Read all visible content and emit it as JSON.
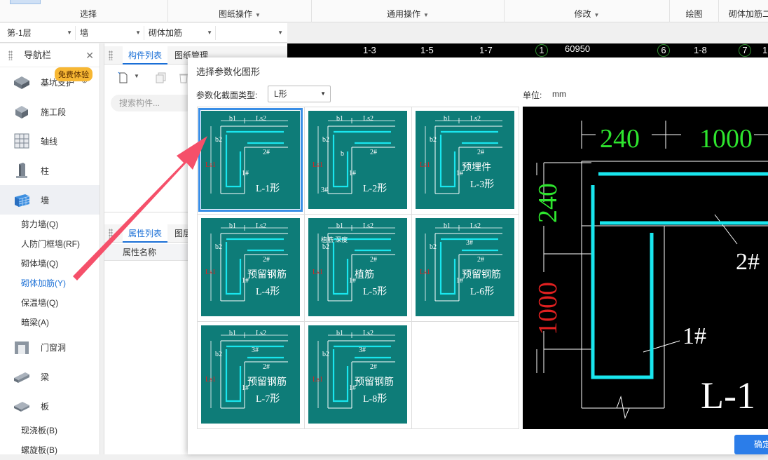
{
  "ribbon": {
    "groups": [
      {
        "label": "选择",
        "has_menu": false
      },
      {
        "label": "图纸操作",
        "has_menu": true
      },
      {
        "label": "通用操作",
        "has_menu": true
      },
      {
        "label": "修改",
        "has_menu": true
      },
      {
        "label": "绘图",
        "has_menu": false
      },
      {
        "label": "砌体加筋二",
        "has_menu": false
      }
    ]
  },
  "selectors": {
    "floor": "第-1层",
    "category": "墙",
    "type": "砌体加筋",
    "extra": ""
  },
  "nav": {
    "title": "导航栏",
    "badge": "免费体验",
    "items": [
      {
        "label": "基坑支护",
        "icon": "foundation-pit-icon"
      },
      {
        "label": "施工段",
        "icon": "construction-section-icon"
      },
      {
        "label": "轴线",
        "icon": "axis-grid-icon"
      },
      {
        "label": "柱",
        "icon": "column-icon"
      },
      {
        "label": "墙",
        "icon": "wall-icon"
      }
    ],
    "wall_sub": [
      "剪力墙(Q)",
      "人防门框墙(RF)",
      "砌体墙(Q)",
      "砌体加筋(Y)",
      "保温墙(Q)",
      "暗梁(A)"
    ],
    "items2": [
      {
        "label": "门窗洞",
        "icon": "door-window-icon"
      },
      {
        "label": "梁",
        "icon": "beam-icon"
      },
      {
        "label": "板",
        "icon": "slab-icon"
      }
    ],
    "slab_sub": [
      "现浇板(B)",
      "螺旋板(B)"
    ]
  },
  "component": {
    "tabs": [
      "构件列表",
      "图纸管理"
    ],
    "search_placeholder": "搜索构件...",
    "prop_tabs": [
      "属性列表",
      "图层"
    ],
    "prop_header": "属性名称"
  },
  "cad_axes": [
    "1-3",
    "1-5",
    "1-7",
    "1",
    "60950",
    "6",
    "1-8",
    "7",
    "1"
  ],
  "dialog": {
    "title": "选择参数化图形",
    "type_label": "参数化截面类型:",
    "type_value": "L形",
    "unit_label": "单位:",
    "unit_value": "mm",
    "ok_label": "确定",
    "shapes": [
      {
        "name": "L-1形",
        "note": ""
      },
      {
        "name": "L-2形",
        "note": ""
      },
      {
        "name": "L-3形",
        "note": "预埋件"
      },
      {
        "name": "L-4形",
        "note": "预留钢筋"
      },
      {
        "name": "L-5形",
        "note": "植筋"
      },
      {
        "name": "L-6形",
        "note": "预留钢筋"
      },
      {
        "name": "L-7形",
        "note": "预留钢筋"
      },
      {
        "name": "L-8形",
        "note": "预留钢筋"
      }
    ],
    "thumb_labels": {
      "b1": "b1",
      "b2": "b2",
      "ls1": "Ls1",
      "ls2": "Ls2",
      "bar1": "1#",
      "bar2": "2#",
      "bar3": "3#",
      "b": "b",
      "anchor": "植筋 深度"
    },
    "preview": {
      "dim_top1": "240",
      "dim_top2": "1000",
      "dim_left1": "240",
      "dim_left2": "1000",
      "bar1": "1#",
      "bar2": "2#",
      "name": "L-1"
    }
  },
  "colors": {
    "accent": "#1a6fd6",
    "thumb_bg": "#0e7c78",
    "rebar": "#19e6ee",
    "dim_green": "#2ee52e",
    "dim_red": "#e02020"
  }
}
